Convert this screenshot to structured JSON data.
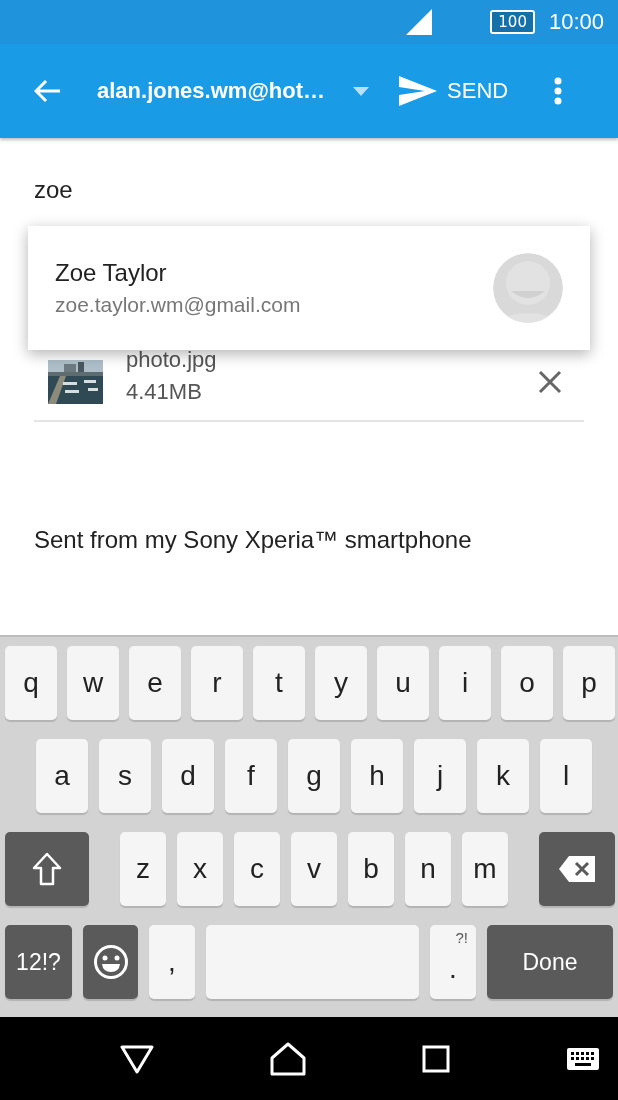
{
  "status_bar": {
    "battery": "100",
    "time": "10:00"
  },
  "app_bar": {
    "from": "alan.jones.wm@hot…",
    "send": "SEND"
  },
  "to_field": {
    "value": "zoe"
  },
  "suggestion": {
    "name": "Zoe Taylor",
    "email": "zoe.taylor.wm@gmail.com"
  },
  "attachment": {
    "name": "photo.jpg",
    "size": "4.41MB"
  },
  "body": "Sent from my Sony Xperia™ smartphone",
  "keyboard": {
    "rows": [
      {
        "keys": [
          {
            "kind": "letter",
            "label": "q"
          },
          {
            "kind": "letter",
            "label": "w"
          },
          {
            "kind": "letter",
            "label": "e"
          },
          {
            "kind": "letter",
            "label": "r"
          },
          {
            "kind": "letter",
            "label": "t"
          },
          {
            "kind": "letter",
            "label": "y"
          },
          {
            "kind": "letter",
            "label": "u"
          },
          {
            "kind": "letter",
            "label": "i"
          },
          {
            "kind": "letter",
            "label": "o"
          },
          {
            "kind": "letter",
            "label": "p"
          }
        ]
      },
      {
        "keys": [
          {
            "kind": "letter",
            "label": "a"
          },
          {
            "kind": "letter",
            "label": "s"
          },
          {
            "kind": "letter",
            "label": "d"
          },
          {
            "kind": "letter",
            "label": "f"
          },
          {
            "kind": "letter",
            "label": "g"
          },
          {
            "kind": "letter",
            "label": "h"
          },
          {
            "kind": "letter",
            "label": "j"
          },
          {
            "kind": "letter",
            "label": "k"
          },
          {
            "kind": "letter",
            "label": "l"
          }
        ]
      },
      {
        "keys": [
          {
            "kind": "shift"
          },
          {
            "kind": "letter",
            "label": "z"
          },
          {
            "kind": "letter",
            "label": "x"
          },
          {
            "kind": "letter",
            "label": "c"
          },
          {
            "kind": "letter",
            "label": "v"
          },
          {
            "kind": "letter",
            "label": "b"
          },
          {
            "kind": "letter",
            "label": "n"
          },
          {
            "kind": "letter",
            "label": "m"
          },
          {
            "kind": "backspace"
          }
        ]
      },
      {
        "keys": [
          {
            "kind": "symbols",
            "label": "12!?"
          },
          {
            "kind": "emoji"
          },
          {
            "kind": "comma",
            "label": ","
          },
          {
            "kind": "space"
          },
          {
            "kind": "period",
            "label": ".",
            "hint": "?!"
          },
          {
            "kind": "done",
            "label": "Done"
          }
        ]
      }
    ]
  }
}
